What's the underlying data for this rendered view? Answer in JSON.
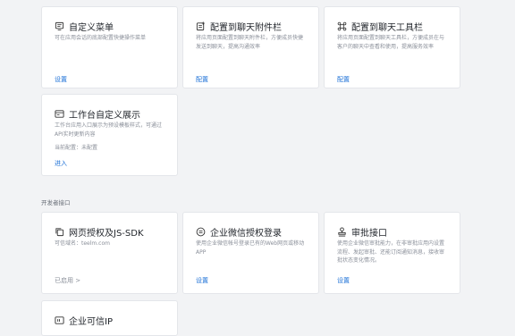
{
  "cards_top": [
    {
      "title": "自定义菜单",
      "desc": "可在应用会话的底部配置快捷操作菜单",
      "action": "设置",
      "icon": "menu-icon"
    },
    {
      "title": "配置到聊天附件栏",
      "desc": "将应用页面配置到聊天附件栏，方便成员快捷发送到聊天，提高沟通效率",
      "action": "配置",
      "icon": "attachment-icon"
    },
    {
      "title": "配置到聊天工具栏",
      "desc": "将应用页面配置到聊天工具栏，方便成员在与客户的聊天中查看和使用，提高服务效率",
      "action": "配置",
      "icon": "command-icon"
    }
  ],
  "workbench_card": {
    "title": "工作台自定义展示",
    "desc": "工作台应用入口展示为预设模板样式，可通过API实时更新内容",
    "current_config": "当前配置：未配置",
    "action": "进入",
    "icon": "workbench-icon"
  },
  "section_label": "开发者接口",
  "cards_bottom": [
    {
      "title": "网页授权及JS-SDK",
      "desc": "可信域名：teelm.com",
      "action": "已启用 >",
      "icon": "copy-icon"
    },
    {
      "title": "企业微信授权登录",
      "desc": "使用企业微信帐号登录已有的Web网页或移动APP",
      "action": "设置",
      "icon": "chat-icon"
    },
    {
      "title": "审批接口",
      "desc": "使用企业微信审批能力，在非审批应用内设置流程、发起审批、还能订阅通知消息，接收审批状态变化情况。",
      "action": "设置",
      "icon": "stamp-icon"
    }
  ],
  "partial_card": {
    "title": "企业可信IP",
    "icon": "ip-icon"
  }
}
